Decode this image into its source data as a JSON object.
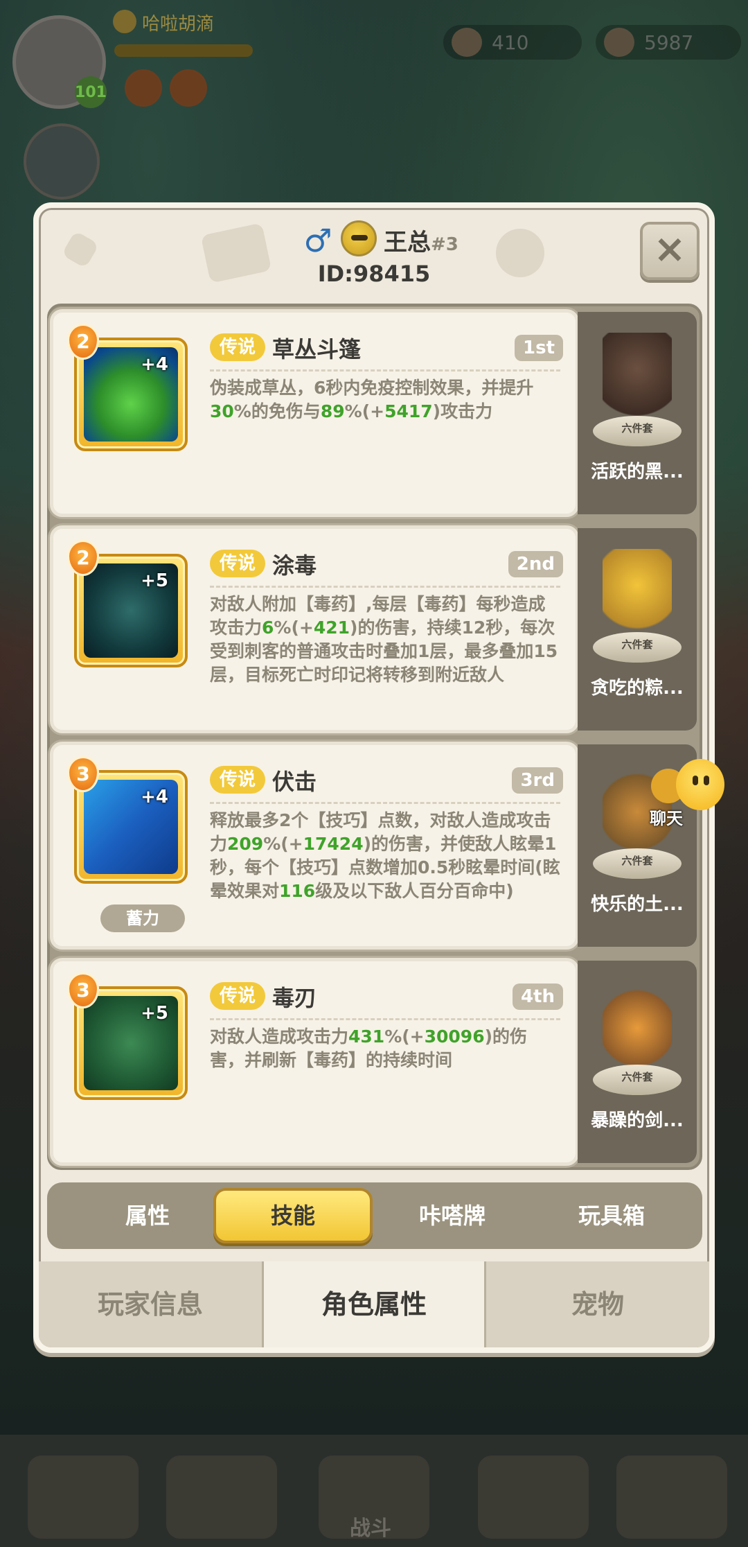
{
  "background": {
    "player_name": "哈啦胡滴",
    "player_level": "101",
    "resource_1": "410",
    "resource_2": "5987",
    "battle_label": "战斗"
  },
  "profile": {
    "gender_symbol": "♂",
    "name": "王总",
    "rank": "#3",
    "id_text": "ID:98415",
    "close_symbol": "×"
  },
  "skills": [
    {
      "level": "2",
      "plus": "+4",
      "rarity": "传说",
      "name": "草丛斗篷",
      "order": "1st",
      "desc_parts": [
        "伪装成草丛，6秒内免疫控制效果，并提升",
        "30",
        "%的免伤与",
        "89",
        "%(+",
        "5417",
        ")攻击力"
      ],
      "icon": "leaf-cloak-icon",
      "outfit": {
        "tag": "六件套",
        "name": "活跃的黑..."
      }
    },
    {
      "level": "2",
      "plus": "+5",
      "rarity": "传说",
      "name": "涂毒",
      "order": "2nd",
      "desc_parts": [
        "对敌人附加【毒药】,每层【毒药】每秒造成攻击力",
        "6",
        "%(+",
        "421",
        ")的伤害，持续12秒，每次受到刺客的普通攻击时叠加1层，最多叠加15层，目标死亡时印记将转移到附近敌人"
      ],
      "icon": "poison-drop-icon",
      "outfit": {
        "tag": "六件套",
        "name": "贪吃的粽..."
      }
    },
    {
      "level": "3",
      "plus": "+4",
      "rarity": "传说",
      "name": "伏击",
      "order": "3rd",
      "desc_parts": [
        "释放最多2个【技巧】点数，对敌人造成攻击力",
        "209",
        "%(+",
        "17424",
        ")的伤害，并使敌人眩晕1秒，每个【技巧】点数增加0.5秒眩晕时间(眩晕效果对",
        "116",
        "级及以下敌人百分百命中)"
      ],
      "icon": "ambush-icon",
      "charge_label": "蓄力",
      "outfit": {
        "tag": "六件套",
        "name": "快乐的土..."
      }
    },
    {
      "level": "3",
      "plus": "+5",
      "rarity": "传说",
      "name": "毒刃",
      "order": "4th",
      "desc_parts": [
        "对敌人造成攻击力",
        "431",
        "%(+",
        "30096",
        ")的伤害，并刷新【毒药】的持续时间"
      ],
      "icon": "poison-skull-icon",
      "outfit": {
        "tag": "六件套",
        "name": "暴躁的剑..."
      }
    }
  ],
  "chat": {
    "label": "聊天"
  },
  "tabs": [
    "属性",
    "技能",
    "咔嗒牌",
    "玩具箱"
  ],
  "bottom_tabs": [
    "玩家信息",
    "角色属性",
    "宠物"
  ],
  "colors": {
    "accent": "#f2c634",
    "highlight_green": "#3fa32a",
    "rarity": "#f2c93a"
  }
}
